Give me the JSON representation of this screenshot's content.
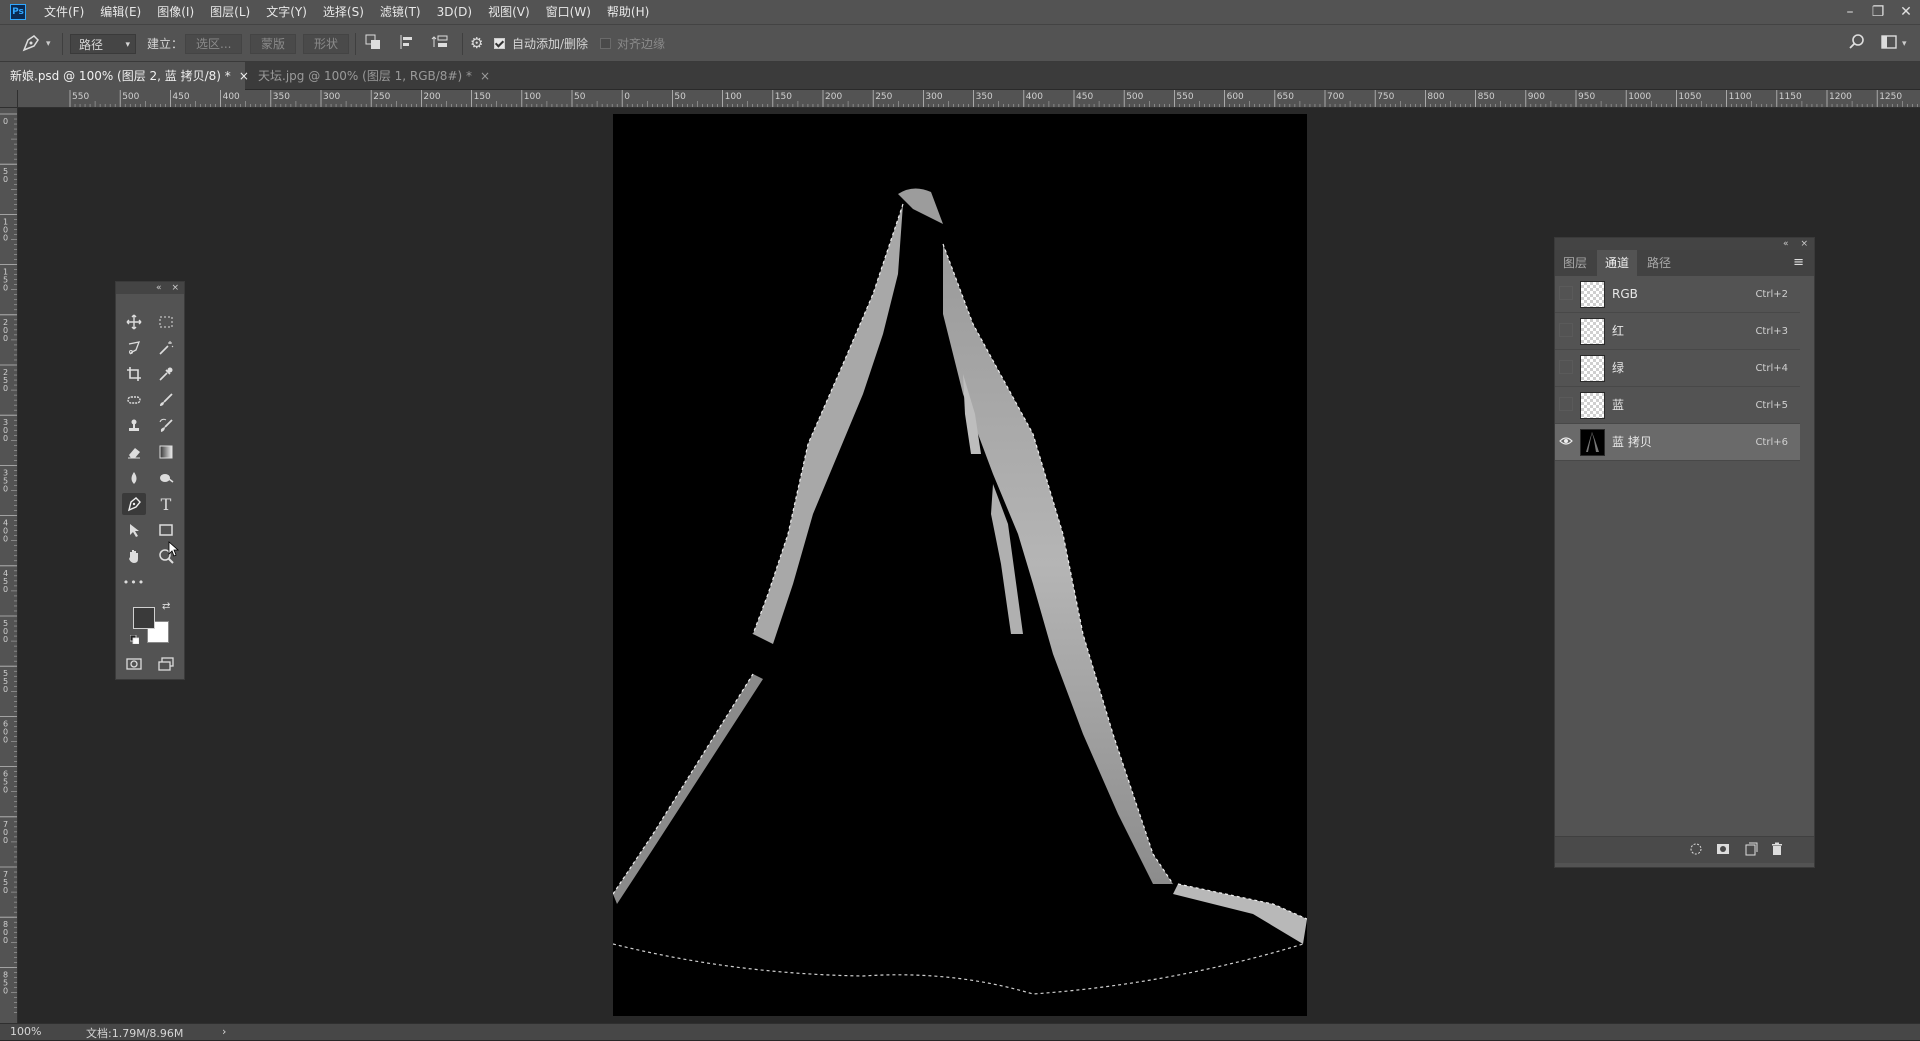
{
  "app": {
    "logo": "Ps"
  },
  "menu": [
    "文件(F)",
    "编辑(E)",
    "图像(I)",
    "图层(L)",
    "文字(Y)",
    "选择(S)",
    "滤镜(T)",
    "3D(D)",
    "视图(V)",
    "窗口(W)",
    "帮助(H)"
  ],
  "window_controls": {
    "minimize": "–",
    "restore": "❐",
    "close": "✕"
  },
  "options": {
    "tool_icon": "pen-icon",
    "mode_select": "路径",
    "make_label": "建立：",
    "selection_button": "选区...",
    "mask_button": "蒙版",
    "shape_button": "形状",
    "auto_add_delete_label": "自动添加/删除",
    "auto_add_delete_checked": true,
    "align_edges_label": "对齐边缘",
    "align_edges_checked": false
  },
  "tabs": [
    {
      "label": "新娘.psd @ 100% (图层 2, 蓝 拷贝/8) *",
      "close": "×",
      "active": true
    },
    {
      "label": "天坛.jpg @ 100% (图层 1, RGB/8#) *",
      "close": "×",
      "active": false
    }
  ],
  "rulers": {
    "top": [
      "550",
      "500",
      "450",
      "400",
      "350",
      "300",
      "250",
      "200",
      "150",
      "100",
      "50",
      "0",
      "50",
      "100",
      "150",
      "200",
      "250",
      "300",
      "350",
      "400",
      "450",
      "500",
      "550",
      "600",
      "650",
      "700",
      "750",
      "800",
      "850",
      "900",
      "950",
      "1000",
      "1050",
      "1100",
      "1150",
      "1200",
      "1250"
    ],
    "left": [
      "0",
      "50",
      "100",
      "150",
      "200",
      "250",
      "300",
      "350",
      "400",
      "450",
      "500",
      "550",
      "600",
      "650",
      "700",
      "750",
      "800",
      "850"
    ]
  },
  "toolbox": {
    "head": {
      "collapse": "«",
      "close": "×"
    },
    "tools": [
      "move-tool",
      "marquee-tool",
      "lasso-tool",
      "magic-wand-tool",
      "crop-tool",
      "eyedropper-tool",
      "healing-brush-tool",
      "brush-tool",
      "clone-stamp-tool",
      "history-brush-tool",
      "eraser-tool",
      "gradient-tool",
      "blur-tool",
      "dodge-tool",
      "pen-tool",
      "type-tool",
      "path-selection-tool",
      "rectangle-tool",
      "hand-tool",
      "zoom-tool",
      "edit-toolbar"
    ],
    "more_label": "•••",
    "type_glyph": "T"
  },
  "channels_panel": {
    "head": {
      "collapse": "«",
      "close": "×"
    },
    "tabs": [
      {
        "label": "图层",
        "active": false
      },
      {
        "label": "通道",
        "active": true
      },
      {
        "label": "路径",
        "active": false
      }
    ],
    "menu_icon": "≡",
    "channels": [
      {
        "name": "RGB",
        "shortcut": "Ctrl+2",
        "visible": false,
        "selected": false
      },
      {
        "name": "红",
        "shortcut": "Ctrl+3",
        "visible": false,
        "selected": false
      },
      {
        "name": "绿",
        "shortcut": "Ctrl+4",
        "visible": false,
        "selected": false
      },
      {
        "name": "蓝",
        "shortcut": "Ctrl+5",
        "visible": false,
        "selected": false
      },
      {
        "name": "蓝 拷贝",
        "shortcut": "Ctrl+6",
        "visible": true,
        "selected": true
      }
    ],
    "bottom_icons": [
      "load-selection-icon",
      "save-selection-icon",
      "new-channel-icon",
      "delete-icon"
    ]
  },
  "status": {
    "zoom": "100%",
    "doc_info": "文档:1.79M/8.96M",
    "arrow": "›"
  }
}
